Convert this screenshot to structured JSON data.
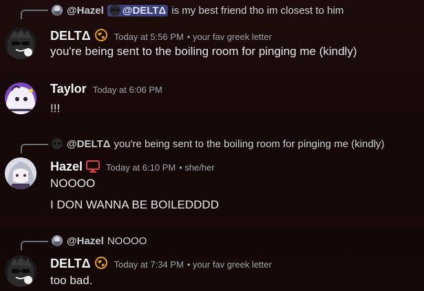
{
  "messages": [
    {
      "reply": {
        "author": "@Hazel",
        "mention": "@DELTΔ",
        "text": "is my best friend tho im closest to him"
      },
      "author": "DELTΔ",
      "badge": "globe-badge",
      "timestamp": "Today at 5:56 PM",
      "tag": "• your fav greek letter",
      "lines": [
        "you're being sent to the boiling room for pinging me (kindly)"
      ]
    },
    {
      "author": "Taylor",
      "timestamp": "Today at 6:06 PM",
      "lines": [
        "!!!"
      ]
    },
    {
      "reply": {
        "author": "@DELTΔ",
        "text": "you're being sent to the boiling room for pinging me (kindly)"
      },
      "author": "Hazel",
      "badge": "monitor-badge",
      "timestamp": "Today at 6:10 PM",
      "tag": "• she/her",
      "lines": [
        "NOOOO",
        "I DON WANNA BE BOILEDDDD"
      ]
    },
    {
      "reply": {
        "author": "@Hazel",
        "text": "NOOOO"
      },
      "author": "DELTΔ",
      "badge": "globe-badge",
      "timestamp": "Today at 7:34 PM",
      "tag": "• your fav greek letter",
      "lines": [
        "too bad."
      ]
    }
  ],
  "colors": {
    "background": "#160908",
    "mention_bg": "#3b3f7a",
    "globe_badge": "#e3a11d",
    "monitor_badge": "#e0404a"
  }
}
